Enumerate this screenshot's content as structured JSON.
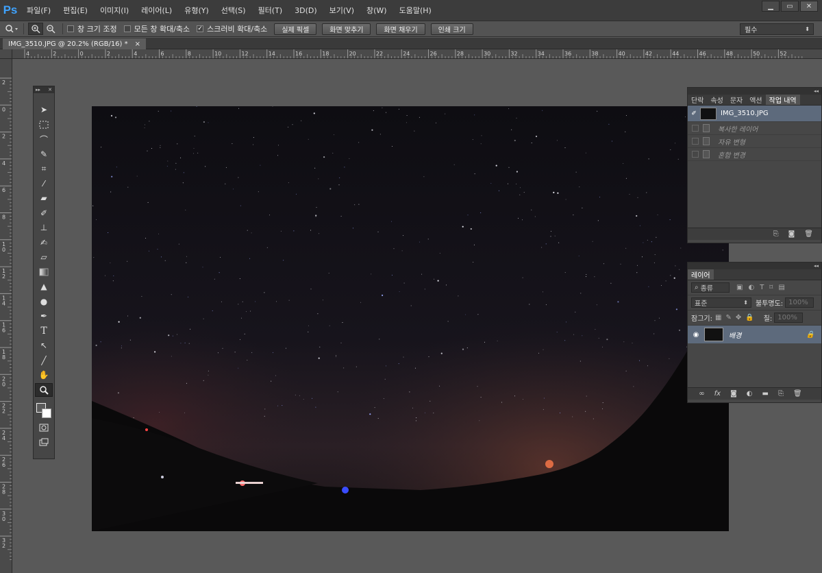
{
  "app": {
    "logo": "Ps"
  },
  "menu": [
    "파일(F)",
    "편집(E)",
    "이미지(I)",
    "레이어(L)",
    "유형(Y)",
    "선택(S)",
    "필터(T)",
    "3D(D)",
    "보기(V)",
    "창(W)",
    "도움말(H)"
  ],
  "window_controls": [
    "▁",
    "▭",
    "✕"
  ],
  "options": {
    "zoom_tool_icon": "zoom-icon",
    "checks": [
      {
        "label": "창 크기 조정",
        "checked": false
      },
      {
        "label": "모든 창 확대/축소",
        "checked": false
      },
      {
        "label": "스크러비 확대/축소",
        "checked": true
      }
    ],
    "buttons": [
      "실제 픽셀",
      "화면 맞추기",
      "화면 채우기",
      "인쇄 크기"
    ],
    "workspace": "필수"
  },
  "document_tab": {
    "title": "IMG_3510.JPG @ 20.2% (RGB/16) *",
    "close": "×"
  },
  "ruler_top": [
    "4",
    "2",
    "0",
    "2",
    "4",
    "6",
    "8",
    "10",
    "12",
    "14",
    "16",
    "18",
    "20",
    "22",
    "24",
    "26",
    "28",
    "30",
    "32",
    "34",
    "36",
    "38",
    "40",
    "42",
    "44",
    "46",
    "48",
    "50",
    "52"
  ],
  "ruler_left": [
    "2",
    "0",
    "2",
    "4",
    "6",
    "8",
    "1\n0",
    "1\n2",
    "1\n4",
    "1\n6",
    "1\n8",
    "2\n0",
    "2\n2",
    "2\n4",
    "2\n6",
    "2\n8",
    "3\n0",
    "3\n2"
  ],
  "history_panel": {
    "tabs": [
      "단락",
      "속성",
      "문자",
      "액션",
      "작업 내역"
    ],
    "active_tab": 4,
    "snapshot": "IMG_3510.JPG",
    "steps": [
      "복사한 레이어",
      "자유 변형",
      "혼합 변경"
    ]
  },
  "layers_panel": {
    "tab": "레이어",
    "filter_label": "종류",
    "blend_mode": "표준",
    "opacity_label": "불투명도:",
    "opacity_value": "100%",
    "lock_label": "잠그기:",
    "fill_label": "칠:",
    "fill_value": "100%",
    "layer_name": "배경"
  }
}
